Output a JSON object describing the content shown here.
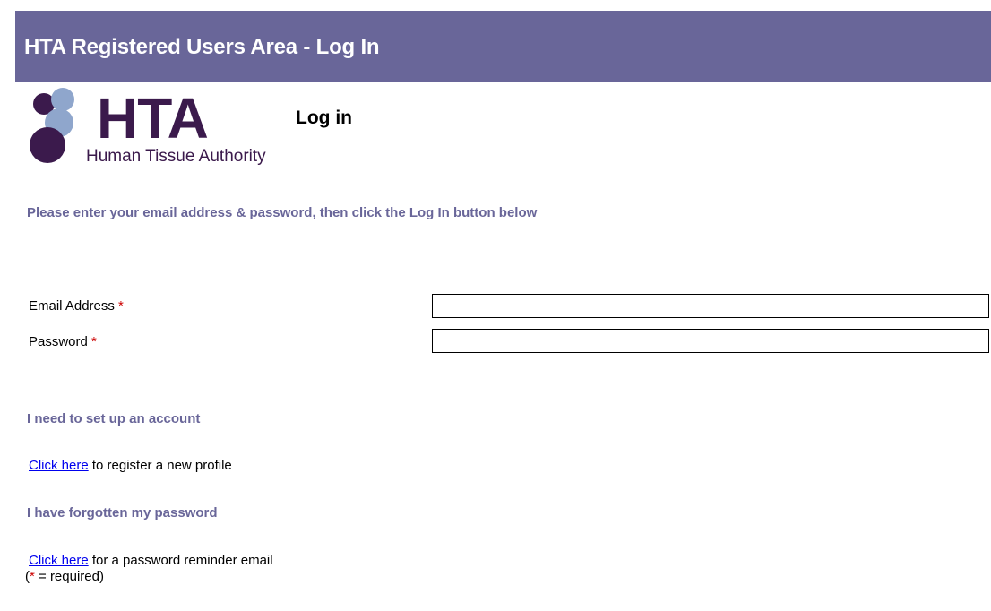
{
  "header": {
    "title": "HTA Registered Users Area - Log In"
  },
  "logo": {
    "abbrev": "HTA",
    "name": "Human Tissue Authority"
  },
  "page": {
    "title": "Log in",
    "instructions": "Please enter your email address & password, then click the Log In button below"
  },
  "form": {
    "email": {
      "label": "Email Address",
      "required_mark": "*",
      "value": ""
    },
    "password": {
      "label": "Password",
      "required_mark": "*",
      "value": ""
    }
  },
  "account": {
    "heading": "I need to set up an account",
    "link_text": "Click here",
    "rest_text": " to register a new profile"
  },
  "forgot": {
    "heading": "I have forgotten my password",
    "link_text": "Click here",
    "rest_text": " for a password reminder email"
  },
  "footnote": {
    "open": "(",
    "mark": "*",
    "rest": " = required)"
  },
  "colors": {
    "header": "#696699",
    "logo_text": "#3b1a4c",
    "link": "#0000ee",
    "required": "#cc0000"
  }
}
